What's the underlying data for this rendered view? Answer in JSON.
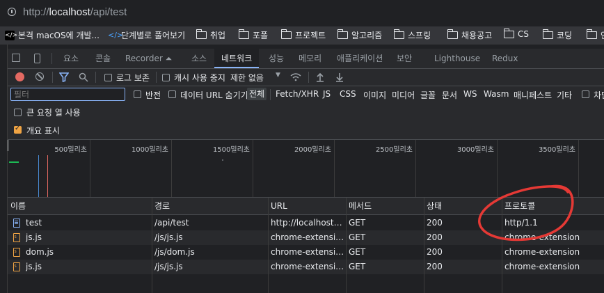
{
  "browser": {
    "url_prefix": "http://",
    "url_host": "localhost",
    "url_path": "/api/test"
  },
  "bookmarks": [
    {
      "label": "본격 macOS에 개발...",
      "icon": "github-icon"
    },
    {
      "label": "단계별로 풀어보기",
      "icon": "code-icon"
    },
    {
      "label": "취업",
      "icon": "folder-icon"
    },
    {
      "label": "포폴",
      "icon": "folder-icon"
    },
    {
      "label": "프로젝트",
      "icon": "folder-icon"
    },
    {
      "label": "알고리즘",
      "icon": "folder-icon"
    },
    {
      "label": "스프링",
      "icon": "folder-icon"
    },
    {
      "label": "채용공고",
      "icon": "folder-icon"
    },
    {
      "label": "CS",
      "icon": "folder-icon"
    },
    {
      "label": "코딩",
      "icon": "folder-icon"
    },
    {
      "label": "인",
      "icon": "folder-icon"
    }
  ],
  "devtools_tabs": [
    "요소",
    "콘솔",
    "Recorder ⏶",
    "소스",
    "네트워크",
    "성능",
    "메모리",
    "애플리케이션",
    "보안",
    "Lighthouse",
    "Redux"
  ],
  "active_tab": "네트워크",
  "toolbar": {
    "preserve_log": "로그 보존",
    "disable_cache": "캐시 사용 중지",
    "throttling": "제한 없음"
  },
  "filter": {
    "placeholder": "필터",
    "invert": "반전",
    "hide_data_urls": "데이터 URL 숨기기",
    "types": [
      "전체",
      "Fetch/XHR",
      "JS",
      "CSS",
      "이미지",
      "미디어",
      "글꼴",
      "문서",
      "WS",
      "Wasm",
      "매니페스트",
      "기타"
    ],
    "active_type": "전체",
    "blocked": "차단"
  },
  "options": {
    "big_rows": "큰 요청 열 사용",
    "overview": "개요 표시",
    "overview_checked": true
  },
  "overview_ticks": [
    "500밀리초",
    "1000밀리초",
    "1500밀리초",
    "2000밀리초",
    "2500밀리초",
    "3000밀리초",
    "3500밀리초"
  ],
  "table": {
    "columns": [
      "이름",
      "경로",
      "URL",
      "메서드",
      "상태",
      "프로토콜"
    ],
    "rows": [
      {
        "name": "test",
        "path": "/api/test",
        "url": "http://localhost/...",
        "method": "GET",
        "status": "200",
        "protocol": "http/1.1",
        "type": "doc"
      },
      {
        "name": "js.js",
        "path": "/js/js.js",
        "url": "chrome-extensio...",
        "method": "GET",
        "status": "200",
        "protocol": "chrome-extension",
        "type": "js"
      },
      {
        "name": "dom.js",
        "path": "/js/dom.js",
        "url": "chrome-extensio...",
        "method": "GET",
        "status": "200",
        "protocol": "chrome-extension",
        "type": "js"
      },
      {
        "name": "js.js",
        "path": "/js/js.js",
        "url": "chrome-extensio...",
        "method": "GET",
        "status": "200",
        "protocol": "chrome-extension",
        "type": "js"
      }
    ]
  },
  "colors": {
    "annotation": "#e53935",
    "accent": "#8ab4f8",
    "record": "#e46962",
    "checkbox": "#f0a444"
  }
}
